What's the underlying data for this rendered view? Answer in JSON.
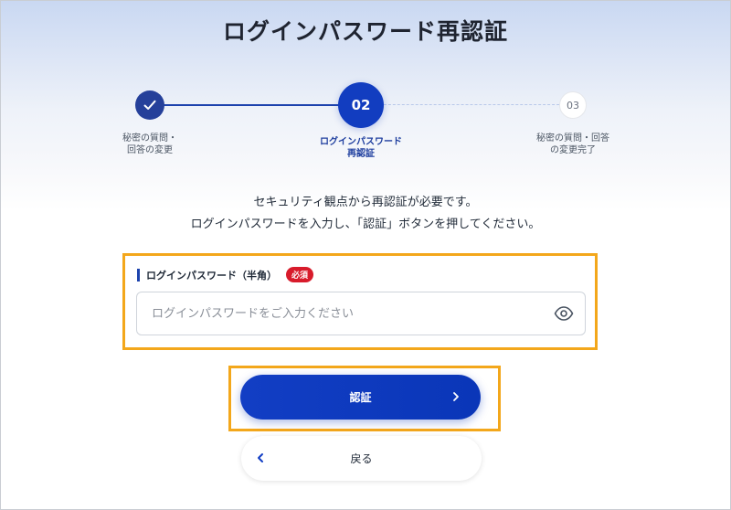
{
  "page": {
    "title": "ログインパスワード再認証"
  },
  "stepper": {
    "steps": [
      {
        "number": "",
        "label_lines": [
          "秘密の質問・",
          "回答の変更"
        ],
        "status": "completed",
        "icon": "check-icon"
      },
      {
        "number": "02",
        "label_lines": [
          "ログインパスワード",
          "再認証"
        ],
        "status": "current"
      },
      {
        "number": "03",
        "label_lines": [
          "秘密の質問・回答",
          "の変更完了"
        ],
        "status": "upcoming"
      }
    ]
  },
  "description": {
    "line1": "セキュリティ観点から再認証が必要です。",
    "line2": "ログインパスワードを入力し、「認証」ボタンを押してください。"
  },
  "password_field": {
    "label": "ログインパスワード（半角）",
    "required_badge": "必須",
    "placeholder": "ログインパスワードをご入力ください",
    "value": "",
    "toggle_icon": "eye-icon"
  },
  "buttons": {
    "auth_label": "認証",
    "back_label": "戻る"
  },
  "colors": {
    "primary": "#123ec4",
    "step_completed": "#25409a",
    "required": "#d81b2b",
    "highlight_border": "#f3a71b"
  }
}
